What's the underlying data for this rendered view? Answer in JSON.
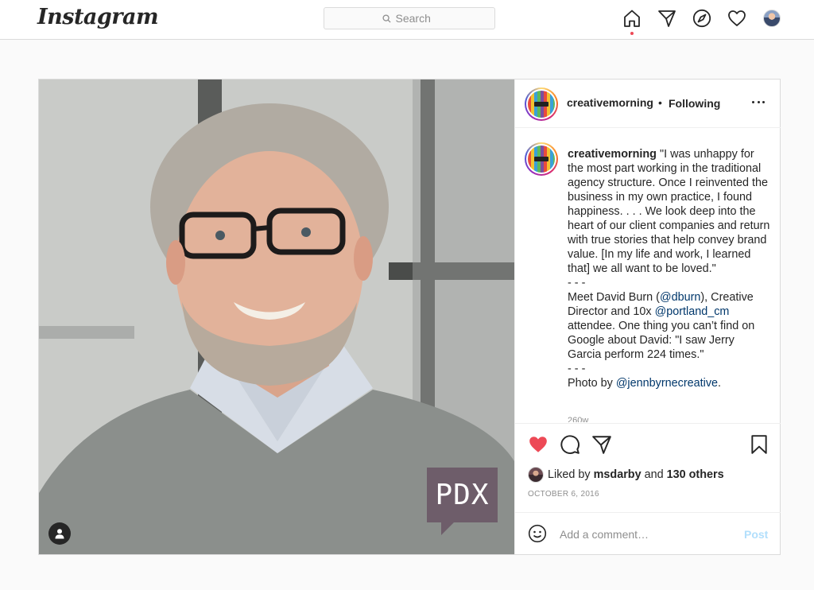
{
  "header": {
    "logo": "Instagram",
    "search_placeholder": "Search",
    "icons": [
      "home-icon",
      "direct-icon",
      "explore-icon",
      "activity-heart-icon",
      "profile-avatar"
    ]
  },
  "post": {
    "username": "creativemorning",
    "separator": "•",
    "follow_status": "Following",
    "caption": {
      "username": "creativemorning",
      "text_1": " \"I was unhappy for the most part working in the traditional agency structure. Once I reinvented the business in my own practice, I found happiness. . . . We look deep into the heart of our client companies and return with true stories that help convey brand value. [In my life and work, I learned that] we all want to be loved.\"\n- - -\nMeet David Burn (",
      "mention_1": "@dburn",
      "text_2": "), Creative Director and 10x ",
      "mention_2": "@portland_cm",
      "text_3": " attendee. One thing you can’t find on Google about David: \"I saw Jerry Garcia perform 224 times.\"\n- - -\nPhoto by ",
      "mention_3": "@jennbyrnecreative",
      "text_4": ".",
      "time_ago": "260w"
    },
    "image_badge": "PDX",
    "likes": {
      "prefix": "Liked by",
      "user": "msdarby",
      "conjunction": "and",
      "others": "130 others"
    },
    "date": "OCTOBER 6, 2016",
    "comment_placeholder": "Add a comment…",
    "post_button": "Post",
    "liked": true,
    "colors": {
      "like_red": "#ed4956",
      "link_blue": "#00376b",
      "post_disabled": "#b2dffc"
    }
  }
}
